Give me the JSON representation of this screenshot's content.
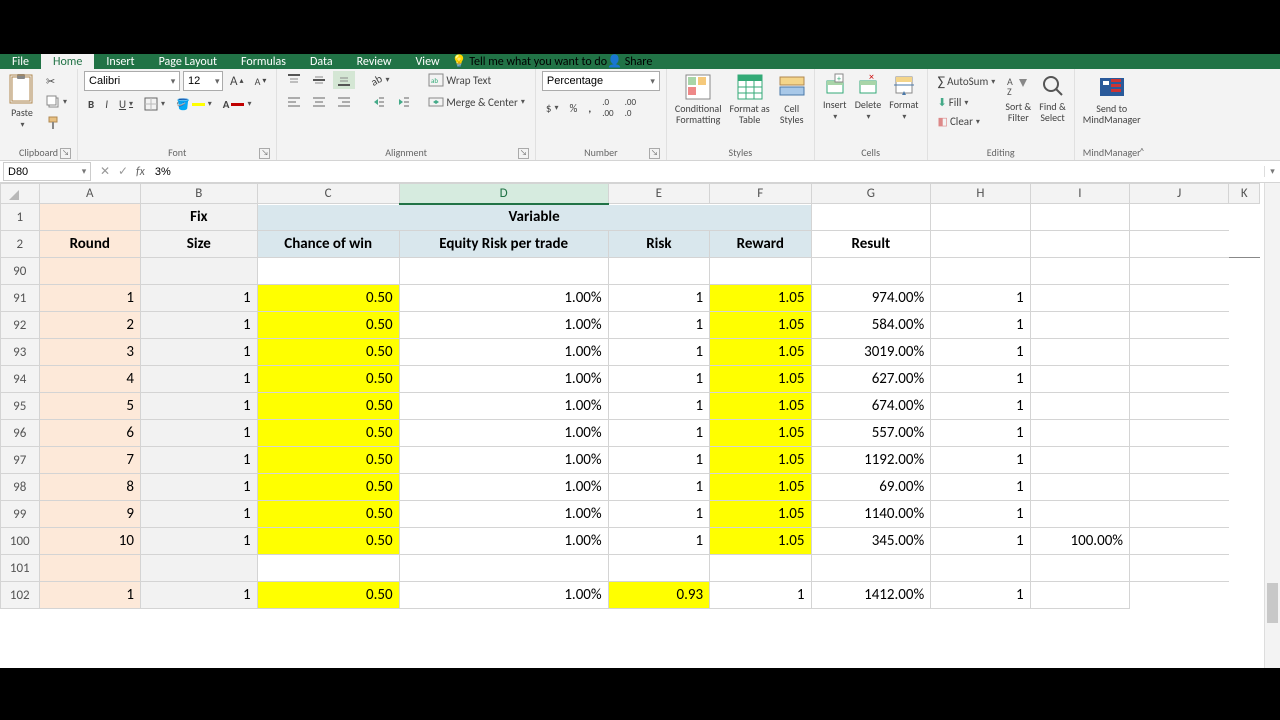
{
  "tabs": {
    "file": "File",
    "home": "Home",
    "insert": "Insert",
    "pageLayout": "Page Layout",
    "formulas": "Formulas",
    "data": "Data",
    "review": "Review",
    "view": "View",
    "tellme": "Tell me what you want to do",
    "share": "Share"
  },
  "ribbon": {
    "clipboard": {
      "label": "Clipboard",
      "paste": "Paste"
    },
    "font": {
      "label": "Font",
      "name": "Calibri",
      "size": "12",
      "bold": "B",
      "italic": "I",
      "underline": "U"
    },
    "alignment": {
      "label": "Alignment",
      "wrap": "Wrap Text",
      "merge": "Merge & Center"
    },
    "number": {
      "label": "Number",
      "format": "Percentage",
      "percent": "%"
    },
    "styles": {
      "label": "Styles",
      "cond": "Conditional\nFormatting",
      "table": "Format as\nTable",
      "cell": "Cell\nStyles"
    },
    "cells": {
      "label": "Cells",
      "insert": "Insert",
      "delete": "Delete",
      "format": "Format"
    },
    "editing": {
      "label": "Editing",
      "autosum": "AutoSum",
      "fill": "Fill",
      "clear": "Clear",
      "sort": "Sort &\nFilter",
      "find": "Find &\nSelect"
    },
    "mindmgr": {
      "label": "MindManager",
      "send": "Send to\nMindManager"
    }
  },
  "fbar": {
    "name": "D80",
    "formula": "3%"
  },
  "cols": [
    "A",
    "B",
    "C",
    "D",
    "E",
    "F",
    "G",
    "H",
    "I",
    "J",
    "K"
  ],
  "headerRow1": {
    "fix": "Fix",
    "variable": "Variable"
  },
  "headerRow2": {
    "round": "Round",
    "size": "Size",
    "chance": "Chance of win",
    "equity": "Equity Risk per trade",
    "risk": "Risk",
    "reward": "Reward",
    "result": "Result"
  },
  "rowNums": [
    "90",
    "91",
    "92",
    "93",
    "94",
    "95",
    "96",
    "97",
    "98",
    "99",
    "100",
    "101",
    "102"
  ],
  "dataRows": [
    {
      "a": "1",
      "b": "1",
      "c": "0.50",
      "d": "1.00%",
      "e": "1",
      "f": "1.05",
      "g": "974.00%",
      "h": "1",
      "i": ""
    },
    {
      "a": "2",
      "b": "1",
      "c": "0.50",
      "d": "1.00%",
      "e": "1",
      "f": "1.05",
      "g": "584.00%",
      "h": "1",
      "i": ""
    },
    {
      "a": "3",
      "b": "1",
      "c": "0.50",
      "d": "1.00%",
      "e": "1",
      "f": "1.05",
      "g": "3019.00%",
      "h": "1",
      "i": ""
    },
    {
      "a": "4",
      "b": "1",
      "c": "0.50",
      "d": "1.00%",
      "e": "1",
      "f": "1.05",
      "g": "627.00%",
      "h": "1",
      "i": ""
    },
    {
      "a": "5",
      "b": "1",
      "c": "0.50",
      "d": "1.00%",
      "e": "1",
      "f": "1.05",
      "g": "674.00%",
      "h": "1",
      "i": ""
    },
    {
      "a": "6",
      "b": "1",
      "c": "0.50",
      "d": "1.00%",
      "e": "1",
      "f": "1.05",
      "g": "557.00%",
      "h": "1",
      "i": ""
    },
    {
      "a": "7",
      "b": "1",
      "c": "0.50",
      "d": "1.00%",
      "e": "1",
      "f": "1.05",
      "g": "1192.00%",
      "h": "1",
      "i": ""
    },
    {
      "a": "8",
      "b": "1",
      "c": "0.50",
      "d": "1.00%",
      "e": "1",
      "f": "1.05",
      "g": "69.00%",
      "h": "1",
      "i": ""
    },
    {
      "a": "9",
      "b": "1",
      "c": "0.50",
      "d": "1.00%",
      "e": "1",
      "f": "1.05",
      "g": "1140.00%",
      "h": "1",
      "i": ""
    },
    {
      "a": "10",
      "b": "1",
      "c": "0.50",
      "d": "1.00%",
      "e": "1",
      "f": "1.05",
      "g": "345.00%",
      "h": "1",
      "i": "100.00%"
    }
  ],
  "row102": {
    "a": "1",
    "b": "1",
    "c": "0.50",
    "d": "1.00%",
    "e": "0.93",
    "f": "1",
    "g": "1412.00%",
    "h": "1",
    "i": ""
  }
}
